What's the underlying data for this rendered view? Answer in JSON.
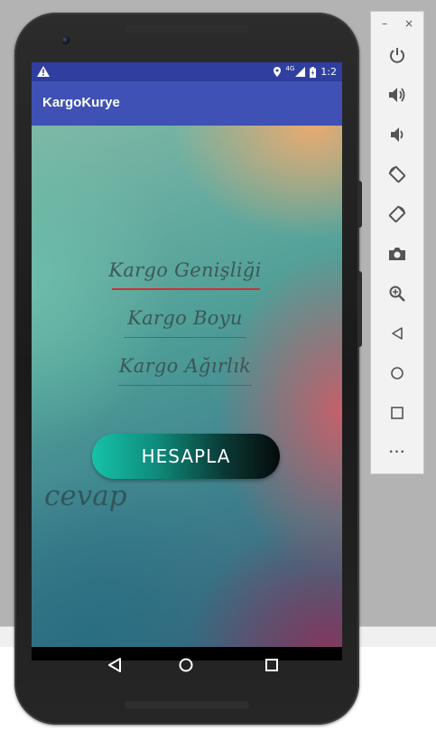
{
  "app": {
    "title": "KargoKurye"
  },
  "status_bar": {
    "time": "1:2",
    "network": "4G",
    "icons": [
      "warning-icon",
      "location-icon",
      "signal-icon",
      "battery-icon"
    ]
  },
  "form": {
    "width_field": "Kargo Genişliği",
    "length_field": "Kargo Boyu",
    "weight_field": "Kargo Ağırlık",
    "calculate_button": "HESAPLA",
    "result_label": "cevap"
  },
  "nav": {
    "icons": [
      "back-icon",
      "home-icon",
      "recents-icon"
    ]
  },
  "emulator_toolbar": {
    "minimize": "–",
    "close": "×",
    "more": "•••",
    "buttons": [
      "power-icon",
      "volume-up-icon",
      "volume-down-icon",
      "rotate-left-icon",
      "rotate-right-icon",
      "camera-icon",
      "zoom-icon",
      "back-icon",
      "home-icon",
      "overview-icon",
      "more-icon"
    ]
  },
  "colors": {
    "status_bar": "#303f9f",
    "app_bar": "#3f51b5",
    "active_underline": "#d32f2f",
    "button_start": "#16c2a8",
    "button_end": "#050a0a"
  }
}
